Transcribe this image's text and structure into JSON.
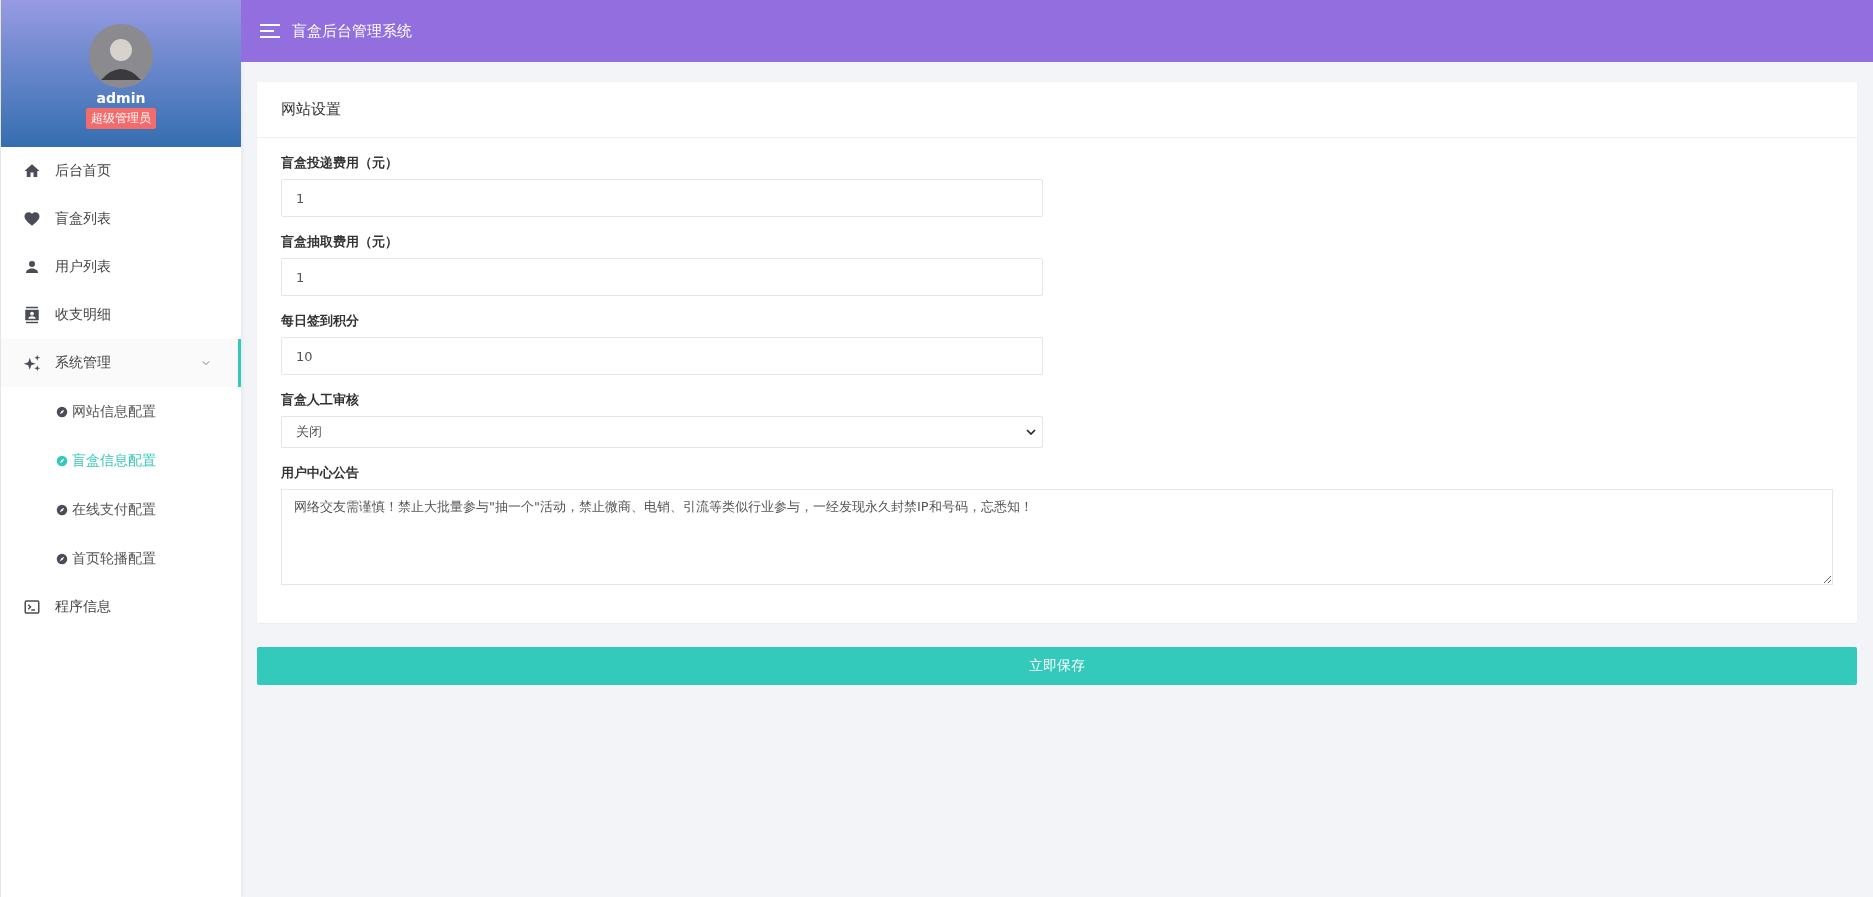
{
  "header": {
    "title": "盲盒后台管理系统"
  },
  "profile": {
    "name": "admin",
    "role": "超级管理员"
  },
  "sidebar": {
    "items": [
      {
        "label": "后台首页",
        "selected": false
      },
      {
        "label": "盲盒列表",
        "selected": false
      },
      {
        "label": "用户列表",
        "selected": false
      },
      {
        "label": "收支明细",
        "selected": false
      },
      {
        "label": "系统管理",
        "selected": true,
        "expanded": true,
        "children": [
          {
            "label": "网站信息配置",
            "selected": false
          },
          {
            "label": "盲盒信息配置",
            "selected": true
          },
          {
            "label": "在线支付配置",
            "selected": false
          },
          {
            "label": "首页轮播配置",
            "selected": false
          }
        ]
      },
      {
        "label": "程序信息",
        "selected": false
      }
    ]
  },
  "card": {
    "title": "网站设置",
    "fields": [
      {
        "kind": "input",
        "label": "盲盒投递费用（元）",
        "value": "1"
      },
      {
        "kind": "input",
        "label": "盲盒抽取费用（元）",
        "value": "1"
      },
      {
        "kind": "input",
        "label": "每日签到积分",
        "value": "10"
      },
      {
        "kind": "select",
        "label": "盲盒人工审核",
        "value": "关闭"
      },
      {
        "kind": "textarea",
        "label": "用户中心公告",
        "value": "网络交友需谨慎！禁止大批量参与\"抽一个\"活动，禁止微商、电销、引流等类似行业参与，一经发现永久封禁IP和号码，忘悉知！"
      }
    ]
  },
  "save_button": "立即保存"
}
